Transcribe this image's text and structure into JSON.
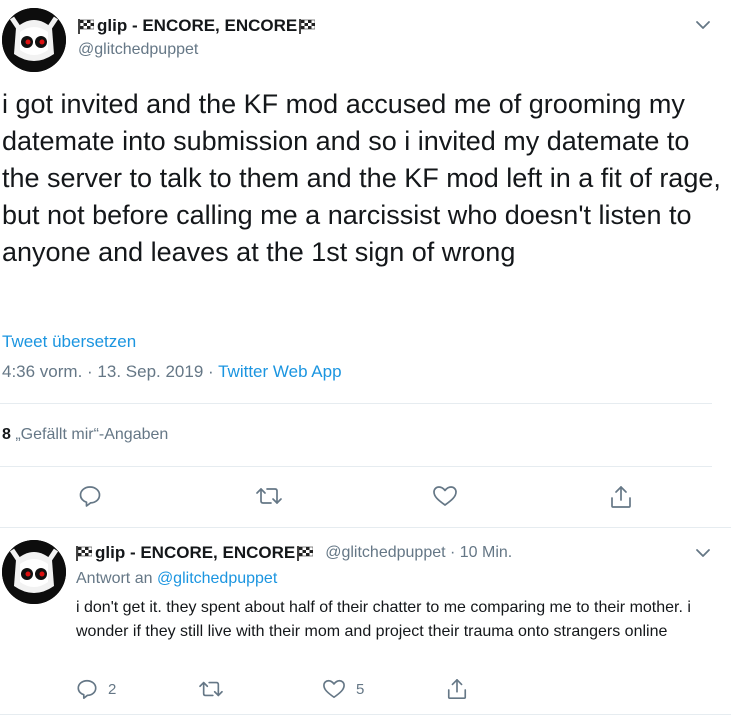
{
  "main_tweet": {
    "display_name": "glip - ENCORE, ENCORE",
    "handle": "@glitchedpuppet",
    "text": "i got invited and the KF mod accused me of grooming my datemate into submission and so i invited my datemate to the server to talk to them and the KF mod left in a fit of rage, but not before calling me a narcissist who doesn't listen to anyone and leaves at the 1st sign of wrong",
    "translate_label": "Tweet übersetzen",
    "time": "4:36 vorm. · 13. Sep. 2019 · ",
    "source": "Twitter Web App",
    "likes_count": "8",
    "likes_label": " „Gefällt mir“-Angaben"
  },
  "reply": {
    "display_name": "glip - ENCORE, ENCORE",
    "handle": "@glitchedpuppet",
    "time_sep": " · ",
    "time": "10 Min.",
    "reply_to_label": "Antwort an ",
    "reply_to_handle": "@glitchedpuppet",
    "text": "i don't get it. they spent about half of their chatter to me comparing me to their mother. i wonder if they still live with their mom and project their trauma onto strangers online",
    "reply_count": "2",
    "like_count": "5"
  },
  "colors": {
    "text": "#14171a",
    "secondary": "#657786",
    "link": "#1b95e0",
    "divider": "#e6ecf0"
  },
  "icons": [
    "checkered-flag-icon",
    "chevron-down-icon",
    "reply-icon",
    "retweet-icon",
    "like-icon",
    "share-icon"
  ]
}
